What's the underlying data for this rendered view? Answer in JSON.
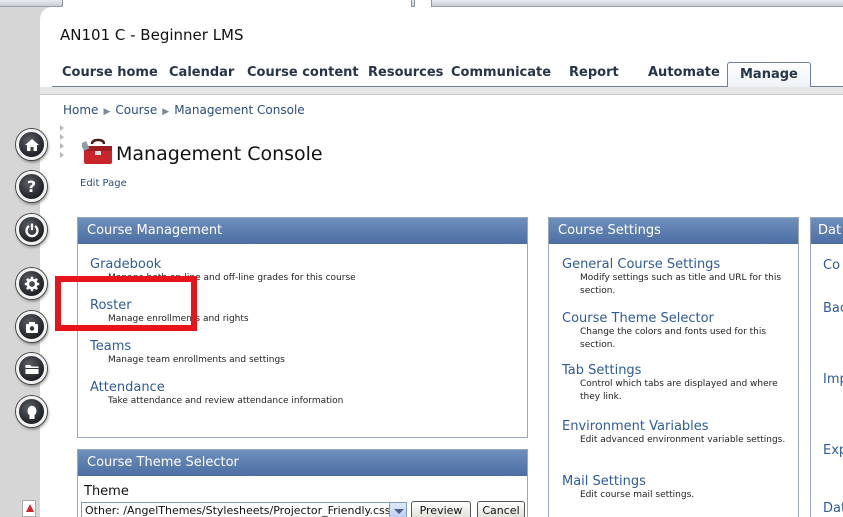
{
  "course": {
    "title": "AN101 C - Beginner LMS"
  },
  "nav": {
    "tabs": [
      {
        "label": "Course home"
      },
      {
        "label": "Calendar"
      },
      {
        "label": "Course content"
      },
      {
        "label": "Resources"
      },
      {
        "label": "Communicate"
      },
      {
        "label": "Report"
      },
      {
        "label": "Automate"
      },
      {
        "label": "Manage",
        "active": true
      }
    ]
  },
  "breadcrumb": {
    "items": [
      "Home",
      "Course",
      "Management Console"
    ]
  },
  "page": {
    "title": "Management Console",
    "edit_link": "Edit Page"
  },
  "rail": {
    "icons": [
      "home-icon",
      "help-icon",
      "power-icon",
      "settings-icon",
      "camera-icon",
      "folder-icon",
      "user-icon"
    ],
    "labels": {
      "help": "?"
    }
  },
  "course_management": {
    "title": "Course Management",
    "items": [
      {
        "label": "Gradebook",
        "desc": "Manage both on-line and off-line grades for this course"
      },
      {
        "label": "Roster",
        "desc": "Manage enrollments and rights"
      },
      {
        "label": "Teams",
        "desc": "Manage team enrollments and settings"
      },
      {
        "label": "Attendance",
        "desc": "Take attendance and review attendance information"
      }
    ]
  },
  "course_settings": {
    "title": "Course Settings",
    "items": [
      {
        "label": "General Course Settings",
        "desc": "Modify settings such as title and URL for this section."
      },
      {
        "label": "Course Theme Selector",
        "desc": "Change the colors and fonts used for this section."
      },
      {
        "label": "Tab Settings",
        "desc": "Control which tabs are displayed and where they link."
      },
      {
        "label": "Environment Variables",
        "desc": "Edit advanced environment variable settings."
      },
      {
        "label": "Mail Settings",
        "desc": "Edit course mail settings."
      }
    ]
  },
  "data_panel": {
    "title": "Dat",
    "fragments": [
      "Co",
      "Bac",
      "Imp",
      "Exp",
      "Dat"
    ]
  },
  "theme_selector": {
    "title": "Course Theme Selector",
    "label": "Theme",
    "selected": "Other: /AngelThemes/Stylesheets/Projector_Friendly.css",
    "preview_label": "Preview",
    "cancel_label": "Cancel"
  },
  "colors": {
    "header_blue": "#4c6ea3",
    "link_blue": "#2f5b9a",
    "highlight_red": "#e8141b"
  }
}
